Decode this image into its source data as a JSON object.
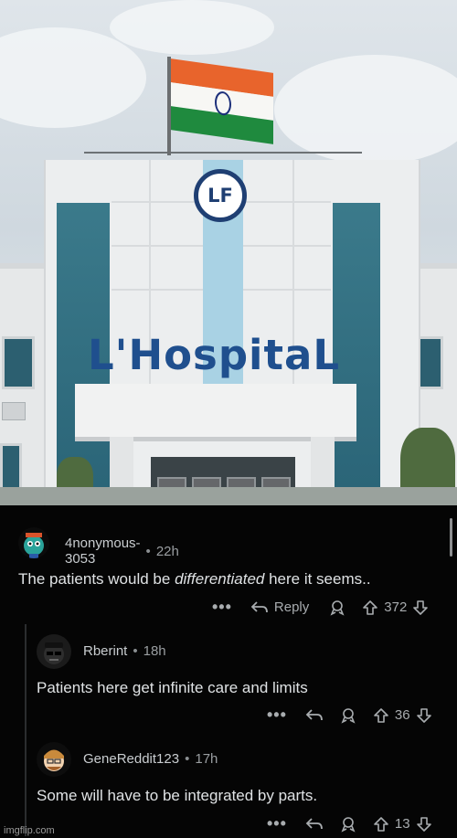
{
  "photo": {
    "sign_text": "L'HospitaL",
    "logo_text": "LF",
    "colors": {
      "sign": "#1f4f8e",
      "saffron": "#e8642c",
      "green": "#1f8a3e",
      "stripe": "#a9d2e4"
    }
  },
  "comments": [
    {
      "username": "4nonymous-3053",
      "time": "22h",
      "text_before": "The patients would be ",
      "text_italic": "differentiated",
      "text_after": " here it seems..",
      "more": "•••",
      "reply_label": "Reply",
      "votes": "372"
    },
    {
      "username": "Rberint",
      "time": "18h",
      "text": "Patients here get infinite care and limits",
      "more": "•••",
      "votes": "36"
    },
    {
      "username": "GeneReddit123",
      "time": "17h",
      "text": "Some will have to be integrated by parts.",
      "more": "•••",
      "votes": "13"
    }
  ],
  "separator": "•",
  "watermark": "imgflip.com",
  "icons": [
    "reply-arrow-icon",
    "award-icon",
    "upvote-arrow-icon",
    "downvote-arrow-icon",
    "more-options-icon"
  ]
}
